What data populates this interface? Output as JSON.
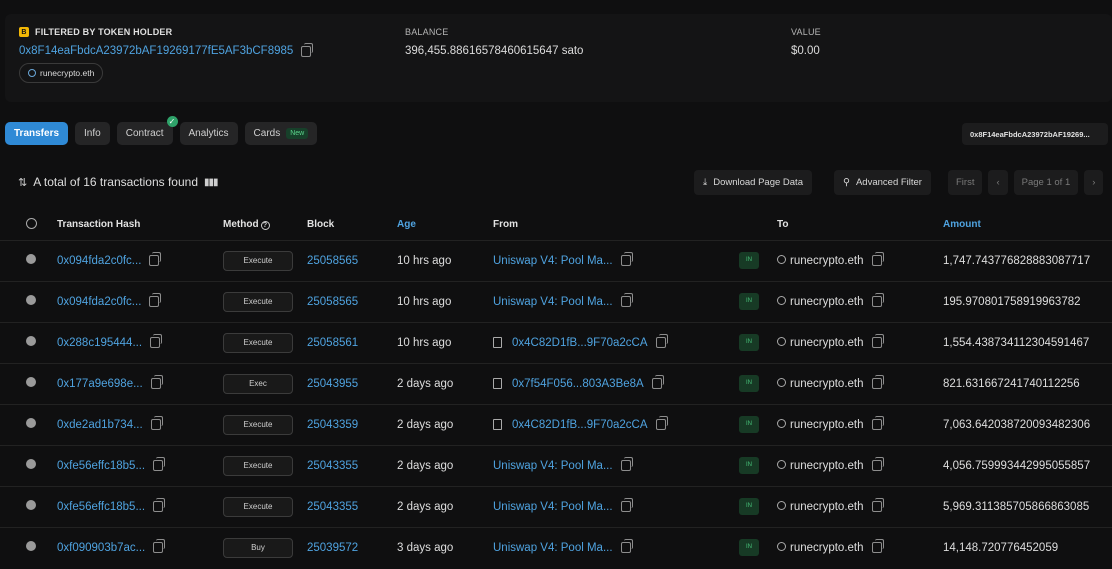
{
  "summary": {
    "filtered_label": "FILTERED BY TOKEN HOLDER",
    "holder_badge": "B",
    "holder_address": "0x8F14eaFbdcA23972bAF19269177fE5AF3bCF8985",
    "holder_ens": "runecrypto.eth",
    "balance_label": "BALANCE",
    "balance_value": "396,455.88616578460615647 sato",
    "value_label": "VALUE",
    "value_value": "$0.00"
  },
  "tabs": [
    {
      "label": "Transfers",
      "active": true
    },
    {
      "label": "Info"
    },
    {
      "label": "Contract",
      "verified_mark": "✓"
    },
    {
      "label": "Analytics"
    },
    {
      "label": "Cards",
      "tag": "New"
    }
  ],
  "address_pill": "0x8F14eaFbdcA23972bAF19269...",
  "toolbar": {
    "total_text": "A total of 16 transactions found",
    "download_label": "Download Page Data",
    "advanced_filter_label": "Advanced Filter",
    "first_label": "First",
    "prev_label": "‹",
    "page_label": "Page 1 of 1",
    "next_label": "›"
  },
  "table": {
    "headers": {
      "hash": "Transaction Hash",
      "method": "Method",
      "block": "Block",
      "age": "Age",
      "from": "From",
      "to": "To",
      "amount": "Amount"
    },
    "rows": [
      {
        "hash": "0x094fda2c0fc...",
        "method": "Execute",
        "block": "25058565",
        "age": "10 hrs ago",
        "from": "Uniswap V4: Pool Ma...",
        "from_contract": false,
        "dir": "IN",
        "to": "runecrypto.eth",
        "amount": "1,747.743776828883087717"
      },
      {
        "hash": "0x094fda2c0fc...",
        "method": "Execute",
        "block": "25058565",
        "age": "10 hrs ago",
        "from": "Uniswap V4: Pool Ma...",
        "from_contract": false,
        "dir": "IN",
        "to": "runecrypto.eth",
        "amount": "195.970801758919963782"
      },
      {
        "hash": "0x288c195444...",
        "method": "Execute",
        "block": "25058561",
        "age": "10 hrs ago",
        "from": "0x4C82D1fB...9F70a2cCA",
        "from_contract": true,
        "dir": "IN",
        "to": "runecrypto.eth",
        "amount": "1,554.438734112304591467"
      },
      {
        "hash": "0x177a9e698e...",
        "method": "Exec",
        "block": "25043955",
        "age": "2 days ago",
        "from": "0x7f54F056...803A3Be8A",
        "from_contract": true,
        "dir": "IN",
        "to": "runecrypto.eth",
        "amount": "821.631667241740112256"
      },
      {
        "hash": "0xde2ad1b734...",
        "method": "Execute",
        "block": "25043359",
        "age": "2 days ago",
        "from": "0x4C82D1fB...9F70a2cCA",
        "from_contract": true,
        "dir": "IN",
        "to": "runecrypto.eth",
        "amount": "7,063.642038720093482306"
      },
      {
        "hash": "0xfe56effc18b5...",
        "method": "Execute",
        "block": "25043355",
        "age": "2 days ago",
        "from": "Uniswap V4: Pool Ma...",
        "from_contract": false,
        "dir": "IN",
        "to": "runecrypto.eth",
        "amount": "4,056.759993442995055857"
      },
      {
        "hash": "0xfe56effc18b5...",
        "method": "Execute",
        "block": "25043355",
        "age": "2 days ago",
        "from": "Uniswap V4: Pool Ma...",
        "from_contract": false,
        "dir": "IN",
        "to": "runecrypto.eth",
        "amount": "5,969.311385705866863085"
      },
      {
        "hash": "0xf090903b7ac...",
        "method": "Buy",
        "block": "25039572",
        "age": "3 days ago",
        "from": "Uniswap V4: Pool Ma...",
        "from_contract": false,
        "dir": "IN",
        "to": "runecrypto.eth",
        "amount": "14,148.720776452059"
      }
    ]
  },
  "colors": {
    "accent": "#2f8ad6",
    "link": "#4fa3e0",
    "in_badge": "#47c27a",
    "background": "#0f0f10"
  }
}
